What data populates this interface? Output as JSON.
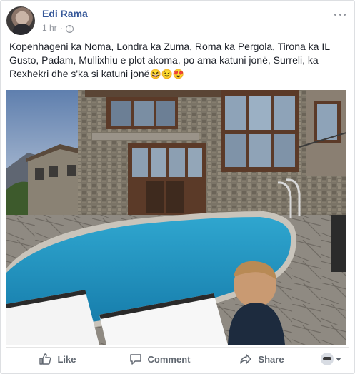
{
  "post": {
    "author": "Edi Rama",
    "time": "1 hr",
    "time_separator": "·",
    "text": "Kopenhageni ka Noma, Londra ka Zuma, Roma ka Pergola, Tirona ka IL Gusto, Padam, Mullixhiu e plot akoma, po ama katuni jonë, Surreli, ka Rexhekri dhe s'ka si katuni jonë",
    "emojis": [
      "😆",
      "😉",
      "😍"
    ]
  },
  "actions": {
    "like_label": "Like",
    "comment_label": "Comment",
    "share_label": "Share"
  },
  "icons": {
    "privacy": "globe-icon",
    "more": "more-options-icon",
    "like": "thumbs-up-icon",
    "comment": "comment-bubble-icon",
    "share": "share-arrow-icon"
  },
  "colors": {
    "author_link": "#365899",
    "meta_gray": "#90949c",
    "action_gray": "#606770",
    "text": "#1d2129"
  }
}
